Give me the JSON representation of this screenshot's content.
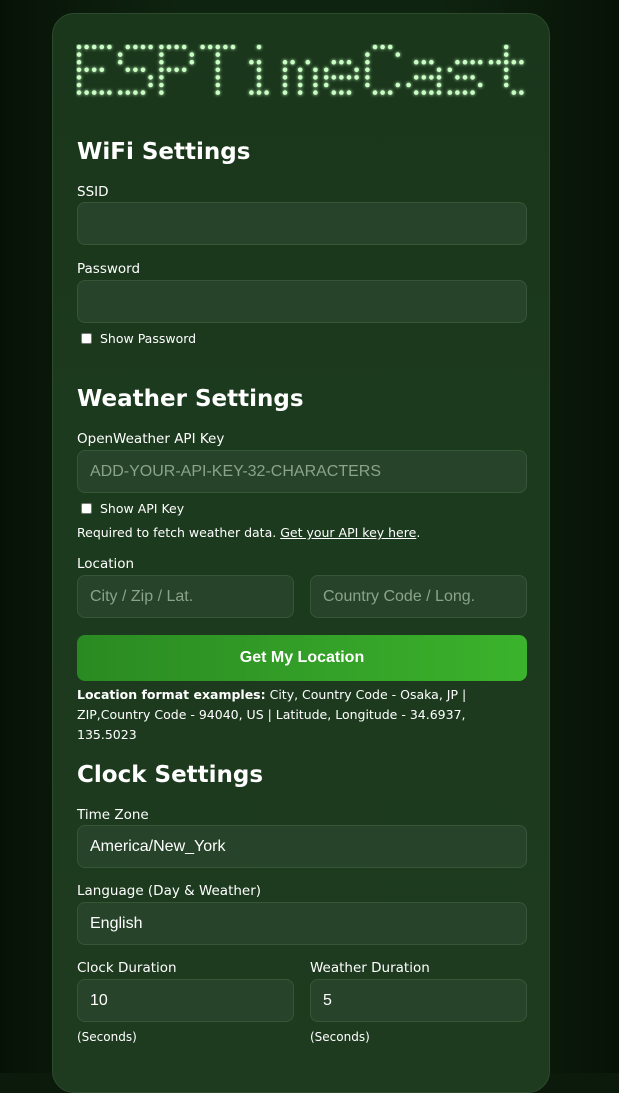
{
  "app": {
    "logo_text": "ESPTimeCast"
  },
  "wifi": {
    "heading": "WiFi Settings",
    "ssid_label": "SSID",
    "ssid_value": "",
    "password_label": "Password",
    "password_value": "",
    "show_password_label": "Show Password"
  },
  "weather": {
    "heading": "Weather Settings",
    "api_key_label": "OpenWeather API Key",
    "api_key_placeholder": "ADD-YOUR-API-KEY-32-CHARACTERS",
    "show_api_key_label": "Show API Key",
    "required_note": "Required to fetch weather data. ",
    "api_link_text": "Get your API key here",
    "api_link_suffix": ".",
    "location_label": "Location",
    "city_placeholder": "City / Zip / Lat.",
    "country_placeholder": "Country Code / Long.",
    "get_location_button": "Get My Location",
    "examples_bold": "Location format examples:",
    "examples_text": " City, Country Code - Osaka, JP | ZIP,Country Code - 94040, US | Latitude, Longitude - 34.6937, 135.5023"
  },
  "clock": {
    "heading": "Clock Settings",
    "timezone_label": "Time Zone",
    "timezone_value": "America/New_York",
    "language_label": "Language (Day & Weather)",
    "language_value": "English",
    "clock_duration_label": "Clock Duration",
    "clock_duration_value": "10",
    "clock_duration_unit": "(Seconds)",
    "weather_duration_label": "Weather Duration",
    "weather_duration_value": "5",
    "weather_duration_unit": "(Seconds)"
  }
}
